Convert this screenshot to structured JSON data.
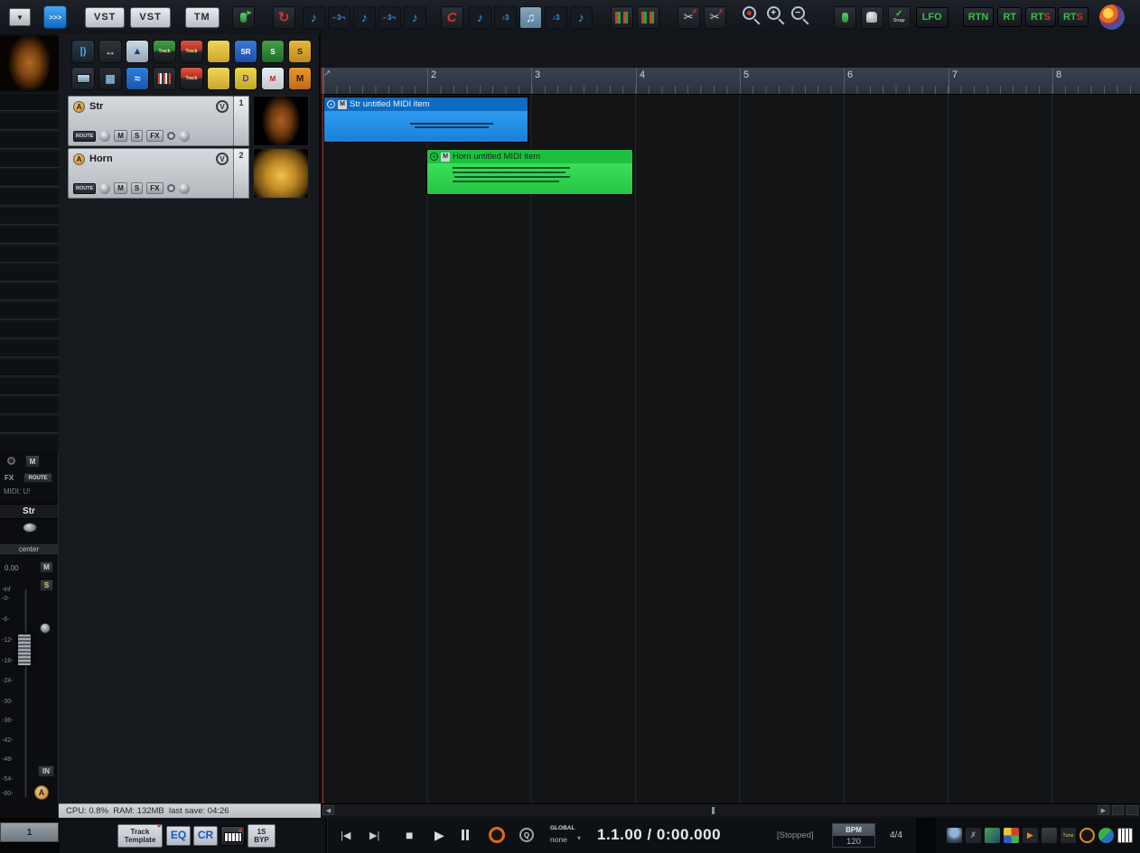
{
  "glyphs": {
    "dropdown": "▼",
    "fast": ">>>",
    "loop_tool": "↻",
    "red_c": "C",
    "scissors": "✂",
    "zoom_plus": "+",
    "zoom_minus": "−",
    "check": "✓",
    "left": "◀",
    "right": "▶",
    "prev": "|◀",
    "next": "▶|",
    "stop": "■",
    "play": "▶",
    "q": "Q",
    "caret_down": "▾",
    "up_right": "↗",
    "power": "●",
    "green_play": "▶",
    "x": "✗"
  },
  "top_toolbar": {
    "vst1": "VST",
    "vst2": "VST",
    "tm": "TM",
    "snap_label": "Snap",
    "lfo": "LFO",
    "rtn": "RTN",
    "rt": "RT",
    "rts_prefix": "RT",
    "rts_suffix": "S"
  },
  "note_row": [
    "♪",
    "⌐3¬",
    "♪",
    "⌐3¬",
    "♪"
  ],
  "quant_row": [
    "♪",
    "♪3",
    "♫",
    "♪3",
    "♪"
  ],
  "tcp_tools_row1": [
    "|)",
    "↔",
    "▲",
    "Track",
    "Track",
    "",
    "SR",
    "S",
    "S"
  ],
  "tcp_tools_row2": [
    "",
    "▦",
    "≈",
    "",
    "Track",
    "",
    "D",
    "M",
    "M"
  ],
  "tracks": [
    {
      "badge": "A",
      "name": "Str",
      "v": "V",
      "route": "ROUTE",
      "mute": "M",
      "solo": "S",
      "fx": "FX",
      "num": "1"
    },
    {
      "badge": "A",
      "name": "Horn",
      "v": "V",
      "route": "ROUTE",
      "mute": "M",
      "solo": "S",
      "fx": "FX",
      "num": "2"
    }
  ],
  "ruler_labels": [
    "2",
    "3",
    "4",
    "5",
    "6",
    "7",
    "8"
  ],
  "midi_items": [
    {
      "m": "M",
      "label": "Str untitled MIDI item"
    },
    {
      "m": "M",
      "label": "Horn untitled MIDI item"
    }
  ],
  "master": {
    "mute": "M",
    "fx": "FX",
    "route": "ROUTE",
    "midi": "MIDI: U!",
    "name": "Str",
    "pan": "center",
    "volume": "0.00",
    "m": "M",
    "s": "S",
    "db": [
      "-inf",
      "-0-",
      "-6-",
      "-12-",
      "-18-",
      "-24-",
      "-30-",
      "-36-",
      "-42-",
      "-48-",
      "-54-",
      "-60-"
    ],
    "in": "IN",
    "badge": "A"
  },
  "status_bar": {
    "text": "CPU: 0.8%  RAM: 132MB  last save: 04:26"
  },
  "bottom": {
    "tab": "1",
    "tt1": "Track",
    "tt2": "Template",
    "tt_star": "*",
    "eq": "EQ",
    "cr": "CR",
    "byp1": "1S",
    "byp2": "BYP",
    "global": "GLOBAL",
    "global_value": "none",
    "time": "1.1.00 / 0:00.000",
    "state": "[Stopped]",
    "bpm_label": "BPM",
    "bpm": "120",
    "sig": "4/4",
    "tune": "Tune"
  },
  "colors": {
    "item_blue": "#1e88e5",
    "item_green": "#2bd14f",
    "accent_orange": "#d4953a"
  }
}
